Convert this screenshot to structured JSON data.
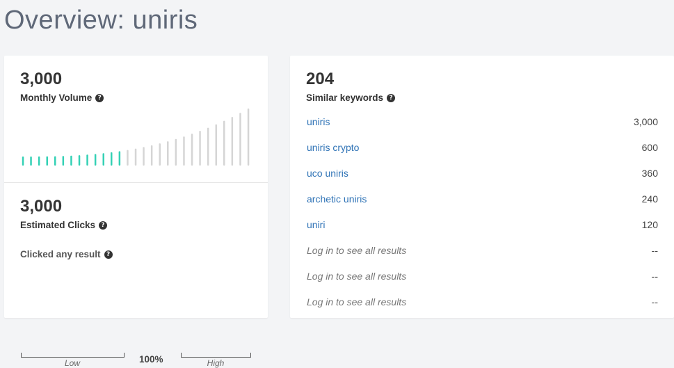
{
  "page": {
    "title": "Overview: uniris"
  },
  "volume": {
    "value": "3,000",
    "label": "Monthly Volume",
    "help": "?",
    "bars_total": 29,
    "bars_active": 13,
    "colors": {
      "active": "#34d1b5",
      "inactive": "#d5d5d5"
    }
  },
  "clicks": {
    "value": "3,000",
    "label": "Estimated Clicks",
    "help": "?",
    "sub_label": "Clicked any result",
    "bars_total": 40,
    "scale": {
      "low": "Low",
      "high": "High",
      "percent": "100%",
      "percent_value": 100
    },
    "colors": {
      "active": "#34d1b5"
    }
  },
  "similar": {
    "count": "204",
    "label": "Similar keywords",
    "help": "?",
    "rows": [
      {
        "keyword": "uniris",
        "value": "3,000",
        "locked": false
      },
      {
        "keyword": "uniris crypto",
        "value": "600",
        "locked": false
      },
      {
        "keyword": "uco uniris",
        "value": "360",
        "locked": false
      },
      {
        "keyword": "archetic uniris",
        "value": "240",
        "locked": false
      },
      {
        "keyword": "uniri",
        "value": "120",
        "locked": false
      },
      {
        "keyword": "Log in to see all results",
        "value": "--",
        "locked": true
      },
      {
        "keyword": "Log in to see all results",
        "value": "--",
        "locked": true
      },
      {
        "keyword": "Log in to see all results",
        "value": "--",
        "locked": true
      }
    ],
    "colors": {
      "link": "#2f73b6"
    }
  }
}
